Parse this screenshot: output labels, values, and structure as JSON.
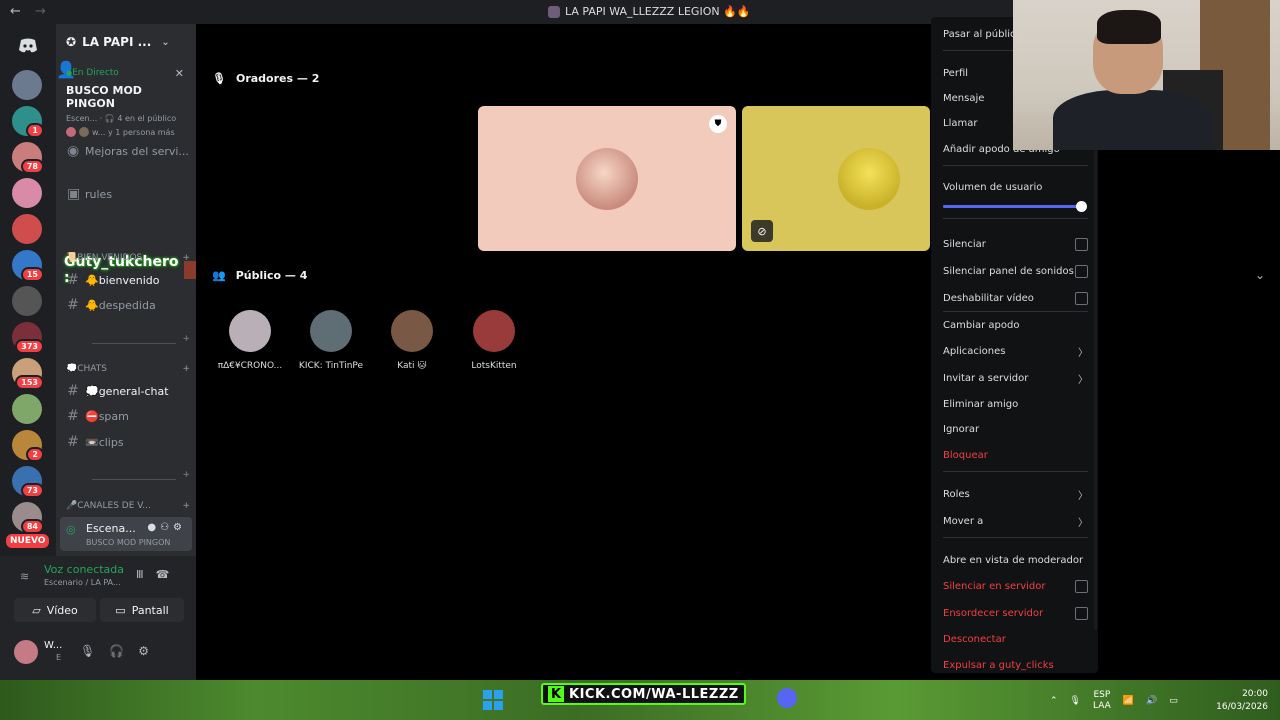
{
  "window": {
    "title": "LA PAPI WA_LLEZZZ LEGION 🔥🔥",
    "back": "←",
    "forward": "→"
  },
  "rail": {
    "badges": [
      "1",
      "78",
      "15",
      "373",
      "153",
      "2",
      "73",
      "84"
    ],
    "nuevo": "NUEVO"
  },
  "server": {
    "name": "LA PAPI ...",
    "live": {
      "status": "En Directo",
      "title": "BUSCO MOD PINGON",
      "meta": "Escen... · 🎧 4 en el público",
      "people": "w... y 1 persona más"
    },
    "channels": [
      {
        "label": "Mejoras del servi..."
      },
      {
        "label": "rules"
      }
    ],
    "overlay_user": "Guty_tukchero :",
    "categories": {
      "bienvenidos": "📜BIEN VENIDOS",
      "chats": "💭CHATS",
      "voice": "🎤CANALES DE V..."
    },
    "text_channels": {
      "bienvenido": "🐥bienvenido",
      "despedida": "🐥despedida",
      "general": "💭general-chat",
      "spam": "⛔spam",
      "clips": "📼clips"
    },
    "stage": {
      "name": "Escena...",
      "sub": "BUSCO MOD PINGON"
    }
  },
  "voice_panel": {
    "connected": "Voz conectada",
    "location": "Escenario / LA PA...",
    "video_label": "Vídeo",
    "screen_label": "Pantall",
    "user_name": "W...",
    "user_status": "E"
  },
  "stage": {
    "speakers_header": "Oradores — 2",
    "audience_header": "Público — 4",
    "audience": [
      {
        "name": "π∆€¥CRONO...",
        "color": "#b9b0b7"
      },
      {
        "name": "KICK: TinTinPe",
        "color": "#5e6e74"
      },
      {
        "name": "Kati 🐱",
        "color": "#7a5846"
      },
      {
        "name": "LotsKitten",
        "color": "#9a3b3b"
      }
    ]
  },
  "context_menu": {
    "items": [
      "Pasar al público",
      "Perfil",
      "Mensaje",
      "Llamar",
      "Añadir apodo de amigo",
      "Volumen de usuario",
      "Silenciar",
      "Silenciar panel de sonidos",
      "Deshabilitar vídeo",
      "Cambiar apodo",
      "Aplicaciones",
      "Invitar a servidor",
      "Eliminar amigo",
      "Ignorar",
      "Bloquear",
      "Roles",
      "Mover a",
      "Abre en vista de moderador",
      "Silenciar en servidor",
      "Ensordecer servidor",
      "Desconectar",
      "Expulsar a guty_clicks"
    ],
    "volume_fraction": 1.0
  },
  "taskbar": {
    "kick_text": "KICK.COM/WA-LLEZZZ",
    "lang_top": "ESP",
    "lang_bottom": "LAA",
    "time": "20:00",
    "date": "16/03/2026"
  }
}
